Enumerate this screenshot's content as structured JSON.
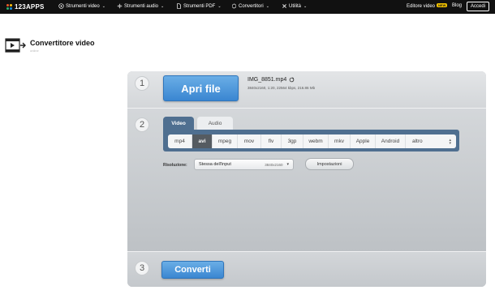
{
  "topbar": {
    "logo": "123APPS",
    "nav": [
      {
        "label": "Strumenti video",
        "icon": "play-circle-icon"
      },
      {
        "label": "Strumenti audio",
        "icon": "waveform-icon"
      },
      {
        "label": "Strumenti PDF",
        "icon": "document-icon"
      },
      {
        "label": "Convertitori",
        "icon": "convert-icon"
      },
      {
        "label": "Utilità",
        "icon": "tools-icon"
      }
    ],
    "editor_label": "Editore video",
    "new_badge": "NEW",
    "blog": "Blog",
    "login": "Accedi"
  },
  "header": {
    "title": "Convertitore video",
    "subtitle": "online"
  },
  "steps": [
    "1",
    "2",
    "3"
  ],
  "open_file": {
    "button": "Apri file",
    "file_name": "IMG_8851.mp4",
    "file_meta": "3840x2160, 1:20, 22564 kbps, 216.86 Mb"
  },
  "tabs": [
    {
      "label": "Video",
      "active": true
    },
    {
      "label": "Audio",
      "active": false
    }
  ],
  "formats": [
    "mp4",
    "avi",
    "mpeg",
    "mov",
    "flv",
    "3gp",
    "webm",
    "mkv",
    "Apple",
    "Android"
  ],
  "selected_format": "avi",
  "other_format": "altro",
  "resolution": {
    "label": "Risoluzione:",
    "selected": "Stessa dell'input",
    "value": "3840x2160"
  },
  "settings_button": "Impostazioni",
  "convert_button": "Converti",
  "colors": {
    "topbar": "#111111",
    "accent_blue": "#3a86d1",
    "tab_active": "#4f6f90",
    "panel": "#bfc3c7",
    "new_badge": "#f2c200"
  }
}
